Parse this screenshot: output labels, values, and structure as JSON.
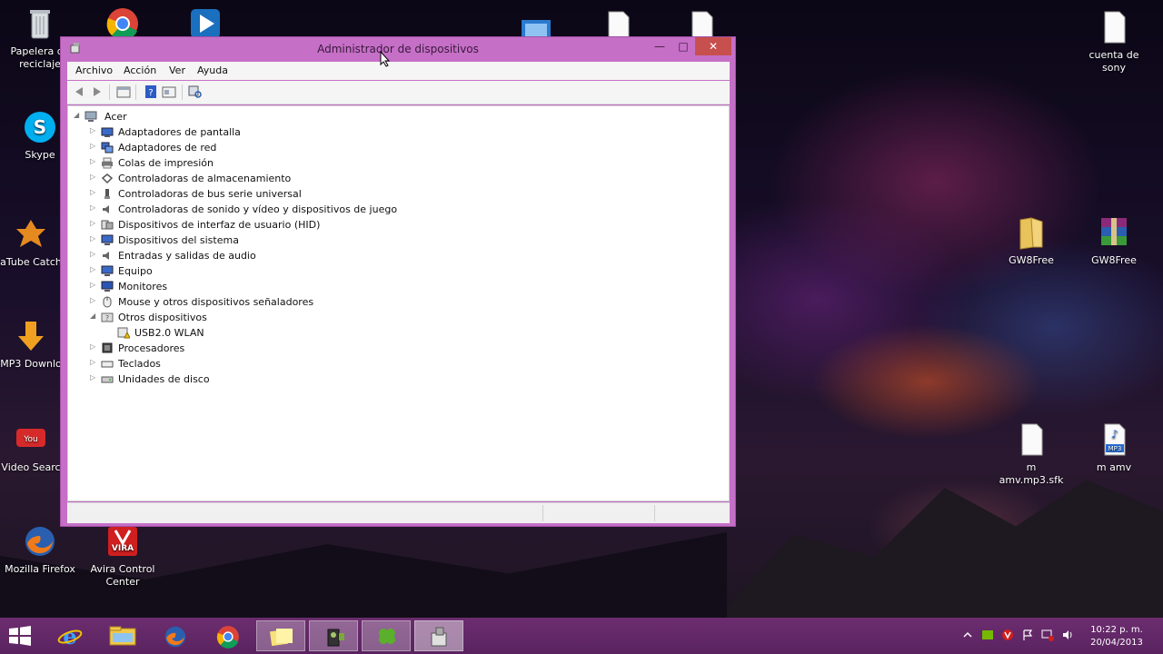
{
  "desktop": {
    "icons_left": [
      {
        "id": "recycle-bin",
        "label_line1": "Papelera de",
        "label_line2": "reciclaje"
      },
      {
        "id": "skype",
        "label_line1": "Skype",
        "label_line2": ""
      },
      {
        "id": "atube",
        "label_line1": "aTube Catch",
        "label_line2": ""
      },
      {
        "id": "mp3dl",
        "label_line1": "MP3 Downlo",
        "label_line2": ""
      },
      {
        "id": "videosearch",
        "label_line1": "Video Searc",
        "label_line2": ""
      },
      {
        "id": "firefox",
        "label_line1": "Mozilla Firefox",
        "label_line2": ""
      },
      {
        "id": "avira",
        "label_line1": "Avira Control",
        "label_line2": "Center"
      }
    ],
    "icons_right": [
      {
        "id": "cuenta-sony",
        "label": "cuenta de sony"
      },
      {
        "id": "gw8free-folder",
        "label": "GW8Free"
      },
      {
        "id": "gw8free-rar",
        "label": "GW8Free"
      },
      {
        "id": "m-amv-sfk",
        "label": "m amv.mp3.sfk"
      },
      {
        "id": "m-amv",
        "label": "m amv"
      }
    ]
  },
  "window": {
    "title": "Administrador de dispositivos",
    "controls": {
      "minimize": "—",
      "maximize": "□",
      "close": "✕"
    },
    "menu": [
      "Archivo",
      "Acción",
      "Ver",
      "Ayuda"
    ],
    "tree": {
      "root": "Acer",
      "categories": [
        {
          "label": "Adaptadores de pantalla",
          "expanded": false
        },
        {
          "label": "Adaptadores de red",
          "expanded": false
        },
        {
          "label": "Colas de impresión",
          "expanded": false
        },
        {
          "label": "Controladoras de almacenamiento",
          "expanded": false
        },
        {
          "label": "Controladoras de bus serie universal",
          "expanded": false
        },
        {
          "label": "Controladoras de sonido y vídeo y dispositivos de juego",
          "expanded": false
        },
        {
          "label": "Dispositivos de interfaz de usuario (HID)",
          "expanded": false
        },
        {
          "label": "Dispositivos del sistema",
          "expanded": false
        },
        {
          "label": "Entradas y salidas de audio",
          "expanded": false
        },
        {
          "label": "Equipo",
          "expanded": false
        },
        {
          "label": "Monitores",
          "expanded": false
        },
        {
          "label": "Mouse y otros dispositivos señaladores",
          "expanded": false
        },
        {
          "label": "Otros dispositivos",
          "expanded": true,
          "children": [
            "USB2.0 WLAN"
          ]
        },
        {
          "label": "Procesadores",
          "expanded": false
        },
        {
          "label": "Teclados",
          "expanded": false
        },
        {
          "label": "Unidades de disco",
          "expanded": false
        }
      ]
    }
  },
  "taskbar": {
    "clock_time": "10:22 p. m.",
    "clock_date": "20/04/2013",
    "items": [
      "start",
      "internet-explorer",
      "file-explorer",
      "firefox",
      "chrome",
      "sticky-notes",
      "media-app",
      "clover-app",
      "device-manager"
    ]
  },
  "colors": {
    "window_frame": "#c56fc7",
    "taskbar": "#5a2360",
    "close_button": "#c7504f"
  }
}
